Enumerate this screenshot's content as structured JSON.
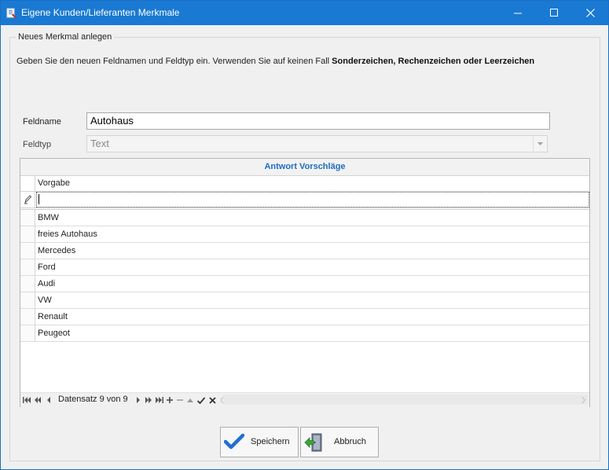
{
  "window": {
    "title": "Eigene Kunden/Lieferanten Merkmale",
    "minimize_icon": "minimize-icon",
    "maximize_icon": "maximize-icon",
    "close_icon": "close-icon"
  },
  "group": {
    "label": "Neues Merkmal anlegen",
    "intro_plain": "Geben Sie den neuen Feldnamen und Feldtyp ein. Verwenden Sie auf keinen Fall ",
    "intro_bold": "Sonderzeichen, Rechenzeichen oder Leerzeichen"
  },
  "form": {
    "feldname_label": "Feldname",
    "feldname_value": "Autohaus",
    "feldtyp_label": "Feldtyp",
    "feldtyp_value": "Text"
  },
  "grid": {
    "caption": "Antwort Vorschläge",
    "column": "Vorgabe",
    "new_row_value": "",
    "rows": [
      "BMW",
      "freies Autohaus",
      "Mercedes",
      "Ford",
      "Audi",
      "VW",
      "Renault",
      "Peugeot"
    ],
    "navigator_text": "Datensatz 9 von 9"
  },
  "buttons": {
    "save_label": "Speichern",
    "cancel_label": "Abbruch"
  },
  "colors": {
    "titlebar": "#1a79d2",
    "caption_text": "#1e6dc2"
  }
}
